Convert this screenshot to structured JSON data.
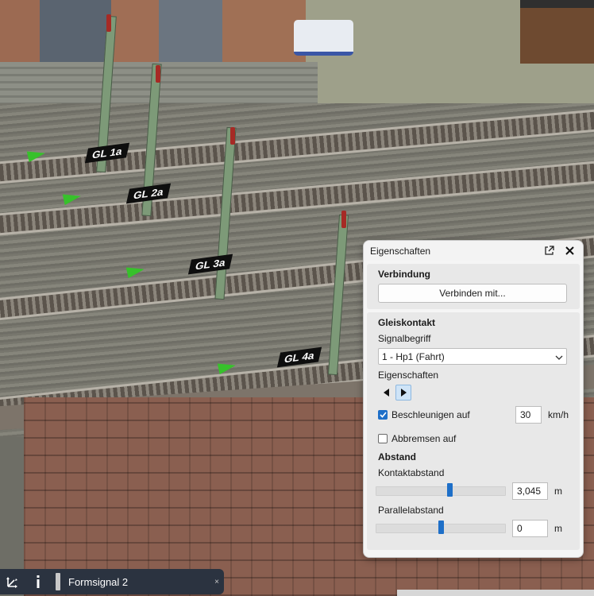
{
  "window": {
    "title": "Eigenschaften"
  },
  "connection": {
    "heading": "Verbindung",
    "connect_button": "Verbinden mit..."
  },
  "contact": {
    "heading": "Gleiskontakt",
    "signal_label": "Signalbegriff",
    "signal_value": "1 - Hp1 (Fahrt)",
    "properties_label": "Eigenschaften",
    "accelerate_label": "Beschleunigen auf",
    "accelerate_checked": true,
    "accelerate_value": "30",
    "accelerate_unit": "km/h",
    "brake_label": "Abbremsen auf",
    "brake_checked": false
  },
  "distance": {
    "heading": "Abstand",
    "contact_label": "Kontaktabstand",
    "contact_value": "3,045",
    "contact_unit": "m",
    "contact_slider_fraction": 0.57,
    "parallel_label": "Parallelabstand",
    "parallel_value": "0",
    "parallel_unit": "m",
    "parallel_slider_fraction": 0.5
  },
  "scene_labels": {
    "track1": "GL 1a",
    "track2": "GL 2a",
    "track3": "GL 3a",
    "track4": "GL 4a"
  },
  "bottombar": {
    "object_name": "Formsignal 2",
    "close": "×"
  },
  "icons": {
    "move": "move-axes-icon",
    "info": "info-icon",
    "popout": "popout-icon",
    "close": "close-icon",
    "chevron": "chevron-down-icon",
    "prev": "arrow-left-icon",
    "next": "arrow-right-icon"
  },
  "colors": {
    "accent": "#1e6fc8",
    "bar": "#2b3340",
    "marker": "#37c12b"
  }
}
